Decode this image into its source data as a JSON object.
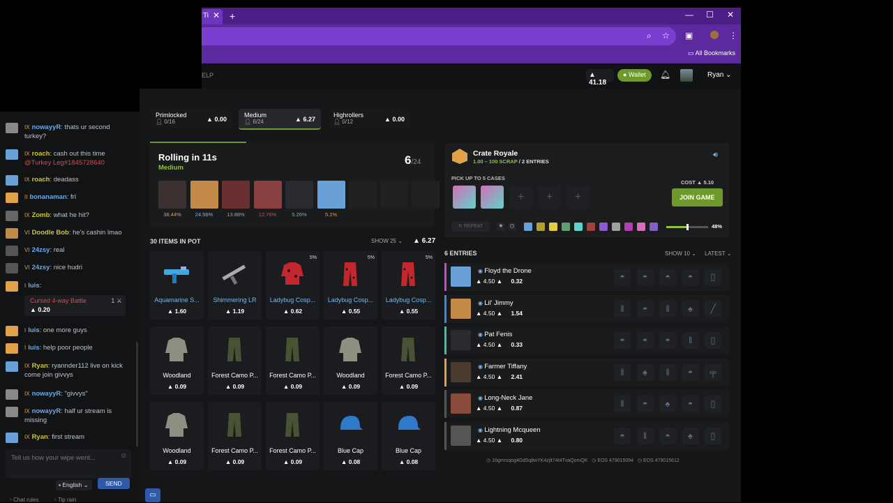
{
  "browser": {
    "tab_title": "Ti",
    "bookmarks_label": "All Bookmarks"
  },
  "header": {
    "nav_fragment": "ELP",
    "balance": "41.18",
    "wallet_label": "Wallet",
    "username": "Ryan"
  },
  "tiers": [
    {
      "name": "Primlocked",
      "players": "0/16",
      "value": "0.00"
    },
    {
      "name": "Medium",
      "players": "6/24",
      "value": "6.27"
    },
    {
      "name": "Highrollers",
      "players": "0/12",
      "value": "0.00"
    }
  ],
  "rolling": {
    "title": "Rolling in 11s",
    "tier": "Medium",
    "count": "6",
    "max": "/24",
    "players": [
      {
        "pct": "38.44%",
        "color": "#e2a04a"
      },
      {
        "pct": "24.56%",
        "color": "#7db8e8"
      },
      {
        "pct": "13.88%",
        "color": "#9aa0a6"
      },
      {
        "pct": "12.76%",
        "color": "#d94b4b"
      },
      {
        "pct": "5.26%",
        "color": "#4ec9a8"
      },
      {
        "pct": "5.1%",
        "color": "#e2a04a"
      }
    ]
  },
  "pot": {
    "title": "30 ITEMS IN POT",
    "show_label": "SHOW 25",
    "total": "6.27",
    "items": [
      {
        "name": "Aquamarine S...",
        "price": "1.60",
        "pct": "",
        "kind": "gun-blue",
        "blue": true
      },
      {
        "name": "Shimmering LR",
        "price": "1.19",
        "pct": "",
        "kind": "gun",
        "blue": true
      },
      {
        "name": "Ladybug Cosp...",
        "price": "0.62",
        "pct": "5%",
        "kind": "red-jacket",
        "blue": true
      },
      {
        "name": "Ladybug Cosp...",
        "price": "0.55",
        "pct": "5%",
        "kind": "red-pants",
        "blue": true
      },
      {
        "name": "Ladybug Cosp...",
        "price": "0.55",
        "pct": "5%",
        "kind": "red-pants",
        "blue": true
      },
      {
        "name": "Woodland",
        "price": "0.09",
        "pct": "",
        "kind": "jacket",
        "blue": false
      },
      {
        "name": "Forest Camo P...",
        "price": "0.09",
        "pct": "",
        "kind": "pants",
        "blue": false
      },
      {
        "name": "Forest Camo P...",
        "price": "0.09",
        "pct": "",
        "kind": "pants",
        "blue": false
      },
      {
        "name": "Woodland",
        "price": "0.09",
        "pct": "",
        "kind": "jacket",
        "blue": false
      },
      {
        "name": "Forest Camo P...",
        "price": "0.09",
        "pct": "",
        "kind": "pants",
        "blue": false
      },
      {
        "name": "Woodland",
        "price": "0.09",
        "pct": "",
        "kind": "jacket",
        "blue": false
      },
      {
        "name": "Forest Camo P...",
        "price": "0.09",
        "pct": "",
        "kind": "pants",
        "blue": false
      },
      {
        "name": "Forest Camo P...",
        "price": "0.09",
        "pct": "",
        "kind": "pants",
        "blue": false
      },
      {
        "name": "Blue Cap",
        "price": "0.08",
        "pct": "",
        "kind": "cap",
        "blue": false
      },
      {
        "name": "Blue Cap",
        "price": "0.08",
        "pct": "",
        "kind": "cap",
        "blue": false
      }
    ]
  },
  "crate": {
    "title": "Crate Royale",
    "range": "1.00 – 100 SCRAP",
    "separator": "/",
    "entries": "2 ENTRIES",
    "pickup_label": "PICK UP TO 5 CASES",
    "cost_label": "COST",
    "cost": "5.10",
    "join_label": "JOIN GAME",
    "repeat_label": "REPEAT",
    "slider_value": "48%",
    "slider_fraction": 0.48
  },
  "entries": {
    "title": "6 ENTRIES",
    "show_label": "SHOW 10",
    "sort_label": "LATEST",
    "rows": [
      {
        "name": "Floyd the Drone",
        "bet": "4.50",
        "won": "0.32",
        "bar": "#c44ad8"
      },
      {
        "name": "Lil' Jimmy",
        "bet": "4.50",
        "won": "1.54",
        "bar": "#3a8ae0"
      },
      {
        "name": "Pat Fenis",
        "bet": "4.50",
        "won": "0.33",
        "bar": "#3ac1a8"
      },
      {
        "name": "Farmer Tiffany",
        "bet": "4.50",
        "won": "2.41",
        "bar": "#e2a04a"
      },
      {
        "name": "Long-Neck Jane",
        "bet": "4.50",
        "won": "0.87",
        "bar": "#555555"
      },
      {
        "name": "Lightning Mcqueen",
        "bet": "4.50",
        "won": "0.80",
        "bar": "#555555"
      }
    ]
  },
  "footer": {
    "hash": "16gmrsqog4Gd5q8wYK4zjlt74t4TvaQomQK",
    "eos1": "EOS 479015094",
    "eos2": "EOS 479015612"
  },
  "chat": {
    "messages": [
      {
        "name": "nowayyR",
        "text": ": thats ur second turkey?",
        "blue": true,
        "lvl": "IX"
      },
      {
        "name": "roach",
        "text": ": cash out this time",
        "mention": "@Turkey Leg#1845728640",
        "lvl": "IX"
      },
      {
        "name": "roach",
        "text": ": deadass",
        "lvl": "IX"
      },
      {
        "name": "bonanaman",
        "text": ": frl",
        "blue": true,
        "lvl": "II"
      },
      {
        "name": "Zomb",
        "text": ": what he hit?",
        "lvl": "IX"
      },
      {
        "name": "Doodle Bob",
        "text": ": he's cashin lmao",
        "lvl": "VI"
      },
      {
        "name": "24zsy",
        "text": ": real",
        "blue": true,
        "lvl": "VI"
      },
      {
        "name": "24zsy",
        "text": ": nice hudri",
        "blue": true,
        "lvl": "VI"
      },
      {
        "name": "luis",
        "text": ":",
        "blue": true,
        "lvl": "I"
      },
      {
        "name": "luis",
        "text": ": one more guys",
        "blue": true,
        "lvl": "I"
      },
      {
        "name": "luis",
        "text": ": help poor people",
        "blue": true,
        "lvl": "I"
      },
      {
        "name": "Ryan",
        "text": ": ryannder112 live on kick come join givvys",
        "lvl": "IX"
      },
      {
        "name": "nowayyR",
        "text": ": \"givvys\"",
        "blue": true,
        "lvl": "IX"
      },
      {
        "name": "nowayyR",
        "text": ": half ur stream is missing",
        "blue": true,
        "lvl": "IX"
      },
      {
        "name": "Ryan",
        "text": ": first stream",
        "lvl": "IX"
      }
    ],
    "battle_name": "Cursed 4-way Battle",
    "battle_count": "1",
    "battle_value": "0.20",
    "input_placeholder": "Tell us how your wipe went...",
    "language": "English",
    "send_label": "SEND",
    "rules_label": "Chat rules",
    "tip_label": "Tip rain"
  }
}
